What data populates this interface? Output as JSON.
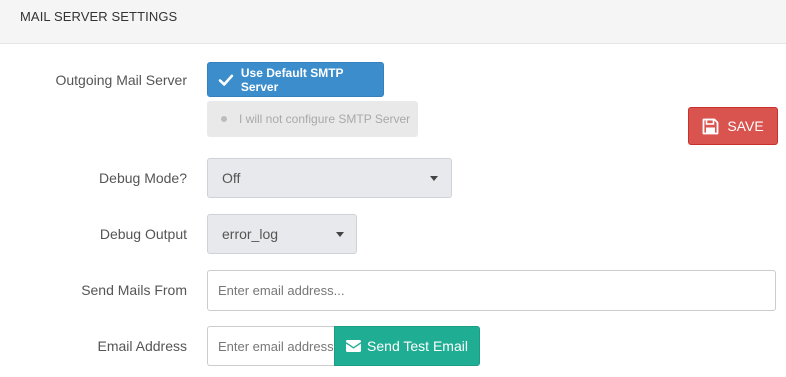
{
  "header": {
    "title": "MAIL SERVER SETTINGS"
  },
  "outgoing": {
    "label": "Outgoing Mail Server",
    "default_button": "Use Default SMTP Server",
    "noconfig_button": "I will not configure SMTP Server"
  },
  "save_button": "SAVE",
  "debug_mode": {
    "label": "Debug Mode?",
    "value": "Off"
  },
  "debug_output": {
    "label": "Debug Output",
    "value": "error_log"
  },
  "send_from": {
    "label": "Send Mails From",
    "placeholder": "Enter email address..."
  },
  "email_address": {
    "label": "Email Address",
    "placeholder": "Enter email address...",
    "button": "Send Test Email"
  },
  "colors": {
    "primary": "#3c8dcc",
    "danger": "#d9534f",
    "success": "#1fae93"
  },
  "icons": [
    "check-icon",
    "save-icon",
    "caret-down-icon",
    "envelope-icon",
    "radio-dot-icon"
  ]
}
